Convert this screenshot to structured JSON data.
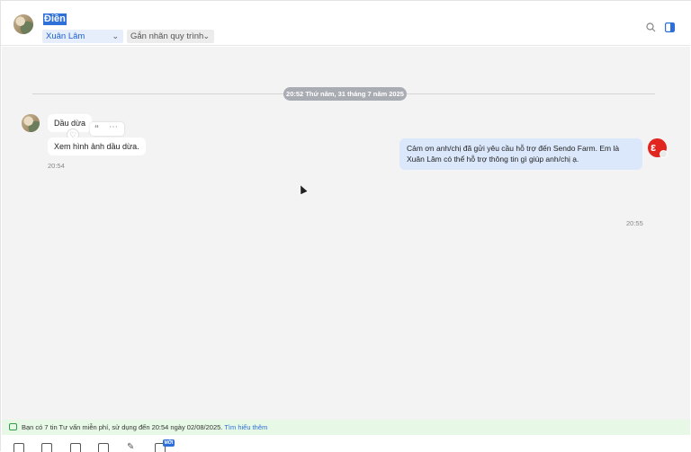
{
  "header": {
    "contact_name": "Điền",
    "assignee": "Xuân Lâm",
    "process_tag": "Gắn nhãn quy trình",
    "icons": [
      "search-icon",
      "panel-toggle-icon"
    ]
  },
  "chat": {
    "date_separator": "20:52 Thứ năm, 31 tháng 7 năm 2025",
    "incoming": {
      "messages": [
        "Dầu dừa",
        "Xem hình ảnh dầu dừa."
      ],
      "time": "20:54",
      "reaction_icons": [
        "quote-icon",
        "more-icon",
        "heart-icon"
      ]
    },
    "outgoing": {
      "text": "Cảm ơn anh/chị đã gửi yêu cầu hỗ trợ đến Sendo Farm. Em là Xuân Lâm có thể hỗ trợ thông tin gì giúp anh/chị ạ.",
      "time": "20:55"
    }
  },
  "notice": {
    "text": "Bạn có 7 tin Tư vấn miễn phí, sử dụng đến 20:54 ngày 02/08/2025. ",
    "link": "Tìm hiểu thêm"
  },
  "toolbar": {
    "badge": "MỚI",
    "icons": [
      "document-icon",
      "image-icon",
      "photo-icon",
      "video-icon",
      "attachment-icon",
      "survey-icon"
    ]
  },
  "colors": {
    "accent": "#2d6fd8",
    "chat_bg": "#f3f3f4",
    "outgoing_bubble": "#dbe8fb",
    "notice_bg": "#e7f9e6",
    "brand_red": "#e0261f"
  }
}
